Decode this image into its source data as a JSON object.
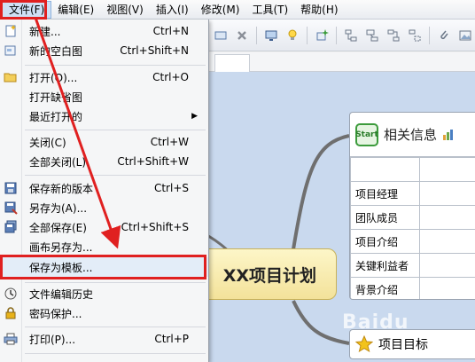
{
  "menubar": {
    "items": [
      {
        "label": "文件(F)"
      },
      {
        "label": "编辑(E)"
      },
      {
        "label": "视图(V)"
      },
      {
        "label": "插入(I)"
      },
      {
        "label": "修改(M)"
      },
      {
        "label": "工具(T)"
      },
      {
        "label": "帮助(H)"
      }
    ]
  },
  "file_menu": {
    "items": [
      {
        "label": "新建...",
        "shortcut": "Ctrl+N",
        "icon": "new-document-icon"
      },
      {
        "label": "新的空白图",
        "shortcut": "Ctrl+Shift+N",
        "icon": "blank-map-icon"
      },
      {
        "label": "打开(O)...",
        "shortcut": "Ctrl+O",
        "icon": "open-folder-icon"
      },
      {
        "label": "打开缺省图",
        "shortcut": ""
      },
      {
        "label": "最近打开的",
        "shortcut": "",
        "submenu": true
      },
      {
        "label": "关闭(C)",
        "shortcut": "Ctrl+W"
      },
      {
        "label": "全部关闭(L)",
        "shortcut": "Ctrl+Shift+W"
      },
      {
        "label": "保存新的版本",
        "shortcut": "Ctrl+S",
        "icon": "save-icon"
      },
      {
        "label": "另存为(A)...",
        "shortcut": "",
        "icon": "save-as-icon"
      },
      {
        "label": "全部保存(E)",
        "shortcut": "Ctrl+Shift+S",
        "icon": "save-all-icon"
      },
      {
        "label": "画布另存为...",
        "shortcut": ""
      },
      {
        "label": "保存为模板...",
        "shortcut": ""
      },
      {
        "label": "文件编辑历史",
        "shortcut": "",
        "icon": "history-clock-icon"
      },
      {
        "label": "密码保护...",
        "shortcut": "",
        "icon": "lock-icon"
      },
      {
        "label": "打印(P)...",
        "shortcut": "Ctrl+P",
        "icon": "printer-icon"
      }
    ],
    "submenu_arrow": "▶"
  },
  "mindmap": {
    "central_topic": "XX项目计划",
    "info_card": {
      "badge": "Start",
      "title": "相关信息",
      "rows": [
        "",
        "项目经理",
        "团队成员",
        "项目介绍",
        "关键利益者",
        "背景介绍"
      ]
    },
    "goal_topic": "项目目标"
  },
  "watermark": "Baidu",
  "colors": {
    "annotation_red": "#e02020",
    "canvas_blue": "#c9d9ee",
    "central_fill": "#f3e29a"
  }
}
